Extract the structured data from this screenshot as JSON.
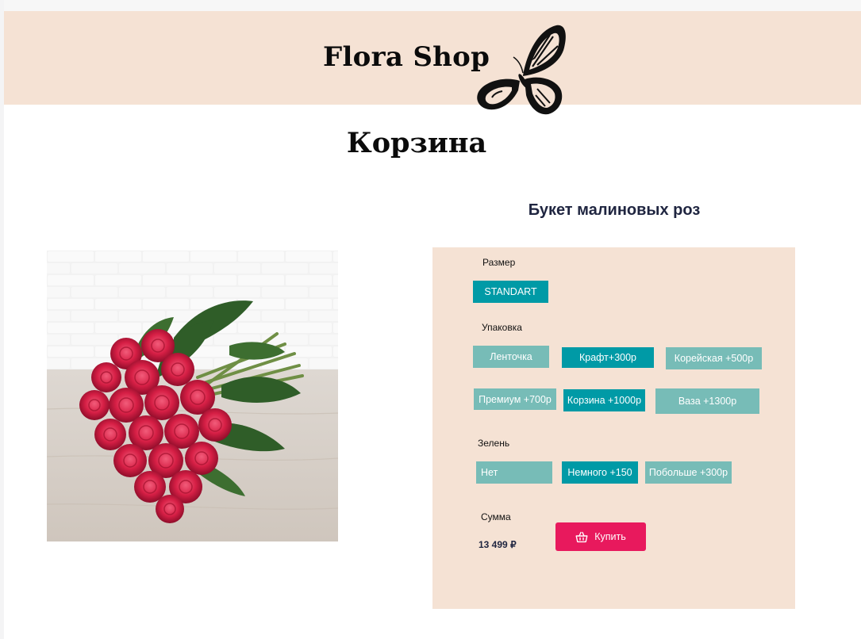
{
  "header": {
    "brand": "Flora Shop",
    "logo_icon": "butterfly-icon"
  },
  "page": {
    "title": "Корзина"
  },
  "product": {
    "name": "Букет малиновых роз",
    "image_desc": "bouquet of raspberry roses on a wooden table"
  },
  "options": {
    "size": {
      "label": "Размер",
      "items": [
        "STANDART"
      ],
      "selected": "STANDART"
    },
    "packaging": {
      "label": "Упаковка",
      "items": [
        "Ленточка",
        "Крафт+300р",
        "Корейская +500р",
        "Премиум +700р",
        "Корзина +1000р",
        "Ваза +1300р"
      ],
      "selected": [
        "Крафт+300р",
        "Корзина +1000р"
      ]
    },
    "greens": {
      "label": "Зелень",
      "items": [
        "Нет",
        "Немного +150",
        "Побольше +300р"
      ],
      "selected": "Немного +150"
    }
  },
  "summary": {
    "label": "Сумма",
    "total": "13 499 ₽"
  },
  "buy_button": {
    "label": "Купить",
    "icon": "basket-icon"
  },
  "colors": {
    "header_bg": "#f5e2d4",
    "selected_option": "#009aa6",
    "unselected_option": "#77bcb7",
    "buy_button": "#e8195d",
    "title_dark": "#1f2540"
  }
}
